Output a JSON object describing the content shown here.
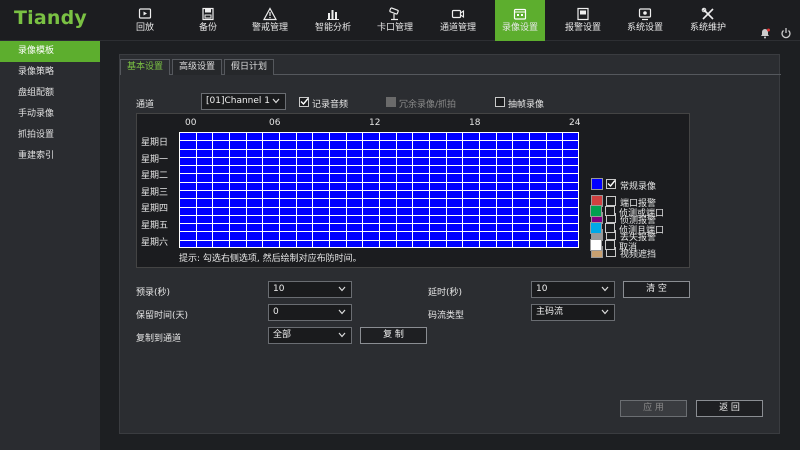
{
  "brand": "Tiandy",
  "nav": [
    {
      "label": "回放",
      "icon": "playback-icon"
    },
    {
      "label": "备份",
      "icon": "backup-icon"
    },
    {
      "label": "警戒管理",
      "icon": "warning-icon"
    },
    {
      "label": "智能分析",
      "icon": "analysis-icon"
    },
    {
      "label": "卡口管理",
      "icon": "camera-icon"
    },
    {
      "label": "通道管理",
      "icon": "channel-icon"
    },
    {
      "label": "录像设置",
      "icon": "record-settings-icon"
    },
    {
      "label": "报警设置",
      "icon": "alarm-settings-icon"
    },
    {
      "label": "系统设置",
      "icon": "system-settings-icon"
    },
    {
      "label": "系统维护",
      "icon": "maintenance-icon"
    }
  ],
  "nav_active_index": 6,
  "sidebar": [
    {
      "label": "录像模板"
    },
    {
      "label": "录像策略"
    },
    {
      "label": "盘组配额"
    },
    {
      "label": "手动录像"
    },
    {
      "label": "抓拍设置"
    },
    {
      "label": "重建索引"
    }
  ],
  "tabs": [
    {
      "label": "基本设置"
    },
    {
      "label": "高级设置"
    },
    {
      "label": "假日计划"
    }
  ],
  "channel": {
    "label": "通道",
    "value": "[01]Channel 1"
  },
  "record_audio": {
    "label": "记录音频",
    "checked": true
  },
  "redundant": {
    "label": "冗余录像/抓拍",
    "checked": false,
    "disabled": true
  },
  "frame_extract": {
    "label": "抽帧录像",
    "checked": false
  },
  "schedule": {
    "hours": [
      "00",
      "06",
      "12",
      "18",
      "24"
    ],
    "days": [
      "星期日",
      "星期一",
      "星期二",
      "星期三",
      "星期四",
      "星期五",
      "星期六"
    ],
    "fill_color": "#0000ff",
    "hint": "提示: 勾选右侧选项, 然后绘制对应布防时间。"
  },
  "legend": [
    {
      "label": "常规录像",
      "color": "#0000ff",
      "checked": true
    },
    {
      "label": "端口报警",
      "color": "#d04040",
      "checked": false
    },
    {
      "label": "侦测报警",
      "color": "#800080",
      "checked": false
    },
    {
      "label": "丢失报警",
      "color": "#9a9a9a",
      "checked": false
    },
    {
      "label": "视频遮挡",
      "color": "#c8a070",
      "checked": false
    },
    {
      "label": "侦测或端口",
      "color": "#00a050",
      "checked": false
    },
    {
      "label": "侦测且端口",
      "color": "#00a8e8",
      "checked": false
    },
    {
      "label": "取消",
      "color": "#ffffff",
      "checked": false
    }
  ],
  "prerecord": {
    "label": "预录(秒)",
    "value": "10"
  },
  "delay": {
    "label": "延时(秒)",
    "value": "10"
  },
  "clear_button": "清 空",
  "retention": {
    "label": "保留时间(天)",
    "value": "0"
  },
  "stream_type": {
    "label": "码流类型",
    "value": "主码流"
  },
  "copy_to": {
    "label": "复制到通道",
    "value": "全部"
  },
  "copy_button": "复 制",
  "apply_button": "应 用",
  "back_button": "返 回",
  "accent_color": "#5dae2e"
}
